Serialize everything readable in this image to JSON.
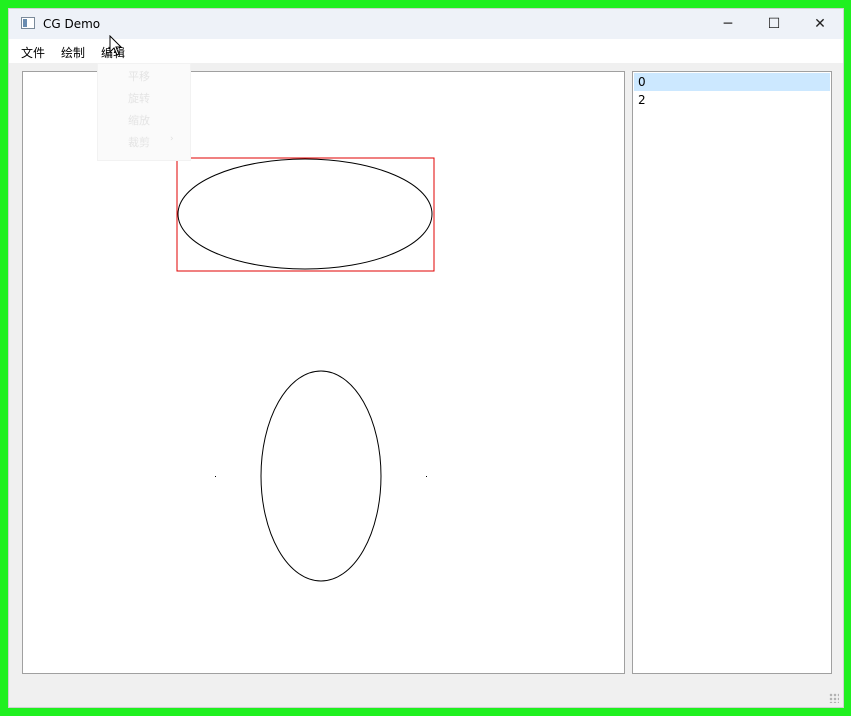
{
  "window": {
    "title": "CG Demo"
  },
  "controls": {
    "minimize": "─",
    "maximize": "☐",
    "close": "✕"
  },
  "menubar": {
    "items": [
      "文件",
      "绘制",
      "编辑"
    ]
  },
  "edit_menu": {
    "items": [
      "平移",
      "旋转",
      "缩放",
      "裁剪"
    ],
    "submenu_arrow": "›"
  },
  "primitives_list": {
    "items": [
      "0",
      "2"
    ],
    "selected": "0"
  },
  "colors": {
    "selection_box": "#e00000",
    "list_selection": "#cce8ff",
    "frame": "#20f020"
  }
}
